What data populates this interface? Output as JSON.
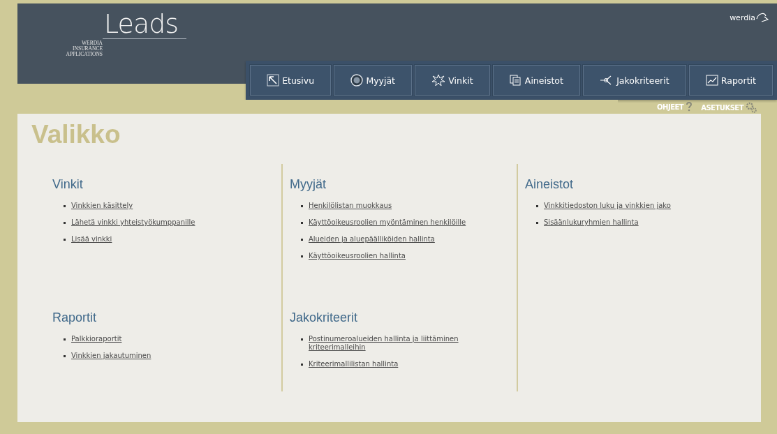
{
  "logo": {
    "title": "Leads",
    "subtitle": [
      "WERDIA",
      "INSURANCE",
      "APPLICATIONS"
    ]
  },
  "brand": "werdia",
  "nav": [
    {
      "label": "Etusivu"
    },
    {
      "label": "Myyjät"
    },
    {
      "label": "Vinkit"
    },
    {
      "label": "Aineistot"
    },
    {
      "label": "Jakokriteerit"
    },
    {
      "label": "Raportit"
    }
  ],
  "help_links": [
    {
      "label": "OHJEET"
    },
    {
      "label": "ASETUKSET"
    }
  ],
  "page_title": "Valikko",
  "columns": [
    [
      {
        "heading": "Vinkit",
        "links": [
          "Vinkkien käsittely",
          "Lähetä vinkki yhteistyökumppanille",
          "Lisää vinkki"
        ]
      },
      {
        "heading": "Raportit",
        "links": [
          "Palkkioraportit",
          "Vinkkien jakautuminen"
        ]
      }
    ],
    [
      {
        "heading": "Myyjät",
        "links": [
          "Henkilölistan muokkaus",
          "Käyttöoikeusroolien myöntäminen henkilöille",
          "Alueiden ja aluepäälliköiden hallinta",
          "Käyttöoikeusroolien hallinta"
        ]
      },
      {
        "heading": "Jakokriteerit",
        "links": [
          "Postinumeroalueiden hallinta ja liittäminen kriteerimalleihin",
          "Kriteerimallilistan hallinta"
        ]
      }
    ],
    [
      {
        "heading": "Aineistot",
        "links": [
          "Vinkkitiedoston luku ja vinkkien jako",
          "Sisäänlukuryhmien hallinta"
        ]
      }
    ]
  ]
}
